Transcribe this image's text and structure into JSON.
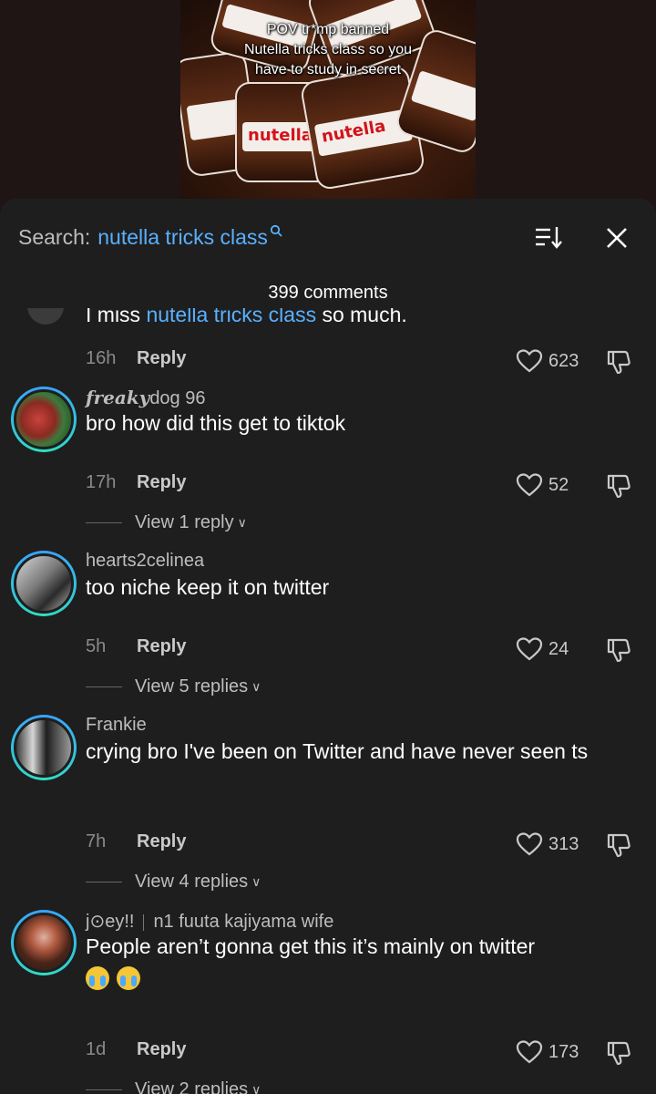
{
  "video": {
    "caption": [
      "POV tr*mp banned",
      "Nutella tricks class so you",
      "have to study in secret"
    ],
    "jar_brand": "nutella"
  },
  "search": {
    "label": "Search:",
    "term": "nutella tricks class"
  },
  "comment_count": "399 comments",
  "partial_comment": {
    "text_start": "I miss ",
    "text_highlight": "nutella tricks class",
    "text_end": " so much.",
    "time": "16h",
    "reply": "Reply",
    "likes": "623"
  },
  "comments": [
    {
      "username_styled": "freaky",
      "username_rest": "dog 96",
      "text": "bro how did this get to tiktok",
      "time": "17h",
      "reply": "Reply",
      "likes": "52",
      "view_replies": "View 1 reply"
    },
    {
      "username": "hearts2celinea",
      "text": "too niche keep it on twitter",
      "time": "5h",
      "reply": "Reply",
      "likes": "24",
      "view_replies": "View 5 replies"
    },
    {
      "username": "Frankie",
      "text": "crying bro I've been on Twitter and have never seen ts",
      "time": "7h",
      "reply": "Reply",
      "likes": "313",
      "view_replies": "View 4 replies"
    },
    {
      "username": "j⊙ey!!",
      "username_extra": "n1 fuuta kajiyama wife",
      "text": "People aren’t gonna get this it’s mainly on twitter",
      "emoji": "😭😭",
      "time": "1d",
      "reply": "Reply",
      "likes": "173",
      "view_replies": "View 2 replies"
    }
  ],
  "icons": {
    "sort": "sort-icon",
    "close": "close-icon",
    "like": "heart-icon",
    "dislike": "thumbs-down-icon",
    "search_mag": "magnifier-icon"
  },
  "colors": {
    "accent": "#5ab0ff",
    "sheet_bg": "#1e1e1e"
  }
}
